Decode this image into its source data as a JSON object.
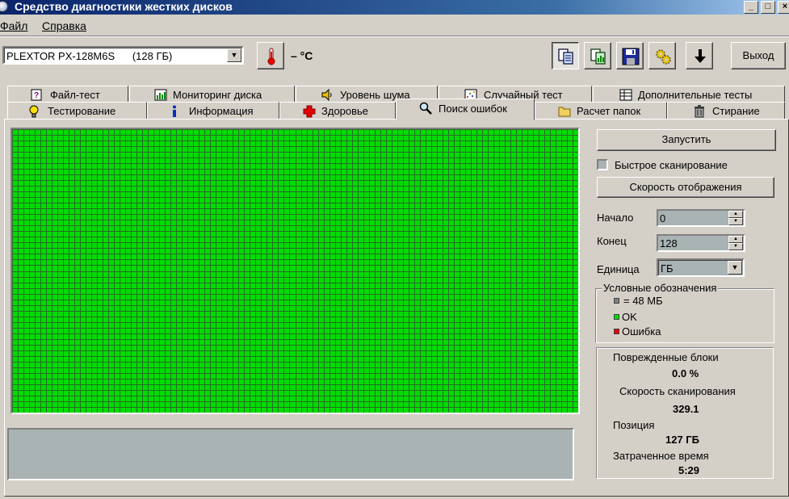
{
  "window": {
    "title": "Средство диагностики жестких дисков"
  },
  "menu": {
    "file": "Файл",
    "help": "Справка"
  },
  "toolbar": {
    "drive": "PLEXTOR PX-128M6S      (128 ГБ)",
    "temperature": "– °C",
    "exit_label": "Выход"
  },
  "tabs": {
    "row_back": [
      "Файл-тест",
      "Мониторинг диска",
      "Уровень шума",
      "Случайный тест",
      "Дополнительные тесты"
    ],
    "row_front": [
      "Тестирование",
      "Информация",
      "Здоровье",
      "Поиск ошибок",
      "Расчет папок",
      "Стирание"
    ],
    "active": "Поиск ошибок"
  },
  "scan": {
    "start_label": "Запустить",
    "fast_scan_label": "Быстрое сканирование",
    "fast_scan_checked": false,
    "display_speed_label": "Скорость отображения",
    "begin_label": "Начало",
    "begin_value": "0",
    "end_label": "Конец",
    "end_value": "128",
    "unit_label": "Единица",
    "unit_value": "ГБ",
    "block_status": "all ok"
  },
  "legend": {
    "title": "Условные обозначения",
    "block_size": "= 48 МБ",
    "ok": "OK",
    "error": "Ошибка",
    "colors": {
      "block": "#808080",
      "ok": "#00dd00",
      "error": "#ee0000"
    }
  },
  "stats": {
    "damaged_label": "Поврежденные блоки",
    "damaged_value": "0.0 %",
    "speed_label": "Скорость сканирования",
    "speed_value": "329.1",
    "position_label": "Позиция",
    "position_value": "127 ГБ",
    "elapsed_label": "Затраченное время",
    "elapsed_value": "5:29"
  }
}
